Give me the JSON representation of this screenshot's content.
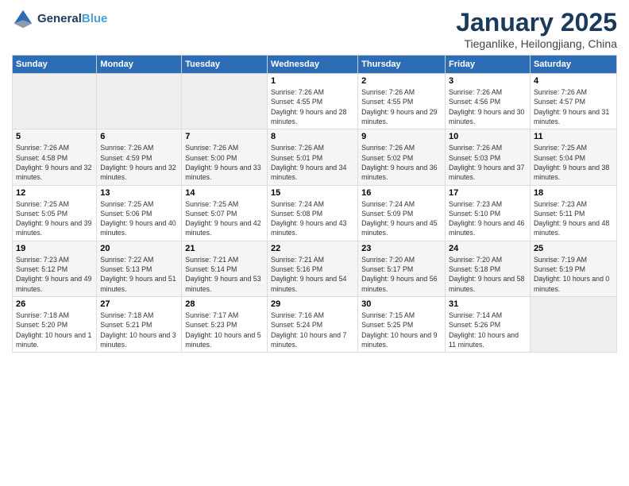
{
  "logo": {
    "line1": "General",
    "line2": "Blue"
  },
  "title": "January 2025",
  "subtitle": "Tieganlike, Heilongjiang, China",
  "header_days": [
    "Sunday",
    "Monday",
    "Tuesday",
    "Wednesday",
    "Thursday",
    "Friday",
    "Saturday"
  ],
  "weeks": [
    [
      {
        "day": "",
        "empty": true
      },
      {
        "day": "",
        "empty": true
      },
      {
        "day": "",
        "empty": true
      },
      {
        "day": "1",
        "sunrise": "Sunrise: 7:26 AM",
        "sunset": "Sunset: 4:55 PM",
        "daylight": "Daylight: 9 hours and 28 minutes."
      },
      {
        "day": "2",
        "sunrise": "Sunrise: 7:26 AM",
        "sunset": "Sunset: 4:55 PM",
        "daylight": "Daylight: 9 hours and 29 minutes."
      },
      {
        "day": "3",
        "sunrise": "Sunrise: 7:26 AM",
        "sunset": "Sunset: 4:56 PM",
        "daylight": "Daylight: 9 hours and 30 minutes."
      },
      {
        "day": "4",
        "sunrise": "Sunrise: 7:26 AM",
        "sunset": "Sunset: 4:57 PM",
        "daylight": "Daylight: 9 hours and 31 minutes."
      }
    ],
    [
      {
        "day": "5",
        "sunrise": "Sunrise: 7:26 AM",
        "sunset": "Sunset: 4:58 PM",
        "daylight": "Daylight: 9 hours and 32 minutes."
      },
      {
        "day": "6",
        "sunrise": "Sunrise: 7:26 AM",
        "sunset": "Sunset: 4:59 PM",
        "daylight": "Daylight: 9 hours and 32 minutes."
      },
      {
        "day": "7",
        "sunrise": "Sunrise: 7:26 AM",
        "sunset": "Sunset: 5:00 PM",
        "daylight": "Daylight: 9 hours and 33 minutes."
      },
      {
        "day": "8",
        "sunrise": "Sunrise: 7:26 AM",
        "sunset": "Sunset: 5:01 PM",
        "daylight": "Daylight: 9 hours and 34 minutes."
      },
      {
        "day": "9",
        "sunrise": "Sunrise: 7:26 AM",
        "sunset": "Sunset: 5:02 PM",
        "daylight": "Daylight: 9 hours and 36 minutes."
      },
      {
        "day": "10",
        "sunrise": "Sunrise: 7:26 AM",
        "sunset": "Sunset: 5:03 PM",
        "daylight": "Daylight: 9 hours and 37 minutes."
      },
      {
        "day": "11",
        "sunrise": "Sunrise: 7:25 AM",
        "sunset": "Sunset: 5:04 PM",
        "daylight": "Daylight: 9 hours and 38 minutes."
      }
    ],
    [
      {
        "day": "12",
        "sunrise": "Sunrise: 7:25 AM",
        "sunset": "Sunset: 5:05 PM",
        "daylight": "Daylight: 9 hours and 39 minutes."
      },
      {
        "day": "13",
        "sunrise": "Sunrise: 7:25 AM",
        "sunset": "Sunset: 5:06 PM",
        "daylight": "Daylight: 9 hours and 40 minutes."
      },
      {
        "day": "14",
        "sunrise": "Sunrise: 7:25 AM",
        "sunset": "Sunset: 5:07 PM",
        "daylight": "Daylight: 9 hours and 42 minutes."
      },
      {
        "day": "15",
        "sunrise": "Sunrise: 7:24 AM",
        "sunset": "Sunset: 5:08 PM",
        "daylight": "Daylight: 9 hours and 43 minutes."
      },
      {
        "day": "16",
        "sunrise": "Sunrise: 7:24 AM",
        "sunset": "Sunset: 5:09 PM",
        "daylight": "Daylight: 9 hours and 45 minutes."
      },
      {
        "day": "17",
        "sunrise": "Sunrise: 7:23 AM",
        "sunset": "Sunset: 5:10 PM",
        "daylight": "Daylight: 9 hours and 46 minutes."
      },
      {
        "day": "18",
        "sunrise": "Sunrise: 7:23 AM",
        "sunset": "Sunset: 5:11 PM",
        "daylight": "Daylight: 9 hours and 48 minutes."
      }
    ],
    [
      {
        "day": "19",
        "sunrise": "Sunrise: 7:23 AM",
        "sunset": "Sunset: 5:12 PM",
        "daylight": "Daylight: 9 hours and 49 minutes."
      },
      {
        "day": "20",
        "sunrise": "Sunrise: 7:22 AM",
        "sunset": "Sunset: 5:13 PM",
        "daylight": "Daylight: 9 hours and 51 minutes."
      },
      {
        "day": "21",
        "sunrise": "Sunrise: 7:21 AM",
        "sunset": "Sunset: 5:14 PM",
        "daylight": "Daylight: 9 hours and 53 minutes."
      },
      {
        "day": "22",
        "sunrise": "Sunrise: 7:21 AM",
        "sunset": "Sunset: 5:16 PM",
        "daylight": "Daylight: 9 hours and 54 minutes."
      },
      {
        "day": "23",
        "sunrise": "Sunrise: 7:20 AM",
        "sunset": "Sunset: 5:17 PM",
        "daylight": "Daylight: 9 hours and 56 minutes."
      },
      {
        "day": "24",
        "sunrise": "Sunrise: 7:20 AM",
        "sunset": "Sunset: 5:18 PM",
        "daylight": "Daylight: 9 hours and 58 minutes."
      },
      {
        "day": "25",
        "sunrise": "Sunrise: 7:19 AM",
        "sunset": "Sunset: 5:19 PM",
        "daylight": "Daylight: 10 hours and 0 minutes."
      }
    ],
    [
      {
        "day": "26",
        "sunrise": "Sunrise: 7:18 AM",
        "sunset": "Sunset: 5:20 PM",
        "daylight": "Daylight: 10 hours and 1 minute."
      },
      {
        "day": "27",
        "sunrise": "Sunrise: 7:18 AM",
        "sunset": "Sunset: 5:21 PM",
        "daylight": "Daylight: 10 hours and 3 minutes."
      },
      {
        "day": "28",
        "sunrise": "Sunrise: 7:17 AM",
        "sunset": "Sunset: 5:23 PM",
        "daylight": "Daylight: 10 hours and 5 minutes."
      },
      {
        "day": "29",
        "sunrise": "Sunrise: 7:16 AM",
        "sunset": "Sunset: 5:24 PM",
        "daylight": "Daylight: 10 hours and 7 minutes."
      },
      {
        "day": "30",
        "sunrise": "Sunrise: 7:15 AM",
        "sunset": "Sunset: 5:25 PM",
        "daylight": "Daylight: 10 hours and 9 minutes."
      },
      {
        "day": "31",
        "sunrise": "Sunrise: 7:14 AM",
        "sunset": "Sunset: 5:26 PM",
        "daylight": "Daylight: 10 hours and 11 minutes."
      },
      {
        "day": "",
        "empty": true
      }
    ]
  ]
}
